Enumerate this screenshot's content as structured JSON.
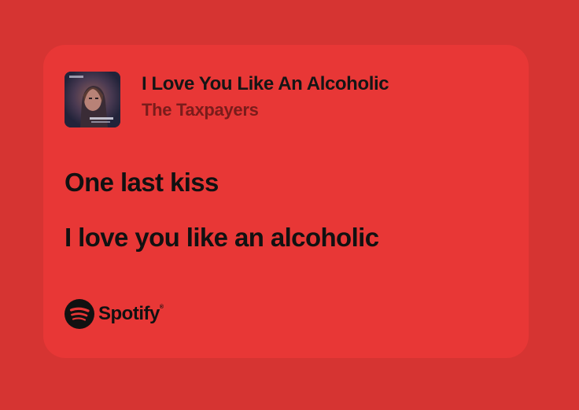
{
  "track": {
    "title": "I Love You Like An Alcoholic",
    "artist": "The Taxpayers"
  },
  "lyrics": [
    "One last kiss",
    "I love you like an alcoholic"
  ],
  "branding": {
    "name": "Spotify",
    "registered_mark": "®",
    "icon": "spotify-logo-icon"
  },
  "colors": {
    "background": "#d63432",
    "card": "#e83736",
    "title_text": "#151515",
    "artist_text": "#7a1c1b",
    "lyric_text": "#111111"
  }
}
